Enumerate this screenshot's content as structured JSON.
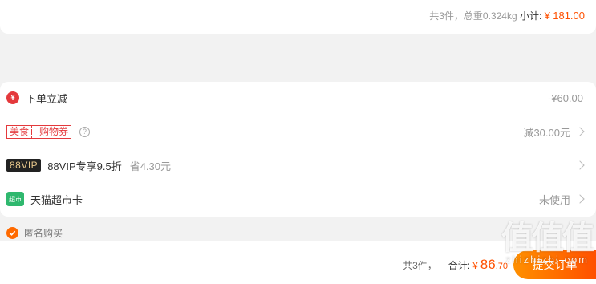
{
  "order_summary": {
    "count_text": "共3件，总重0.324kg",
    "subtotal_label": "小计:",
    "currency": "¥",
    "subtotal_value": "181.00"
  },
  "discounts": {
    "instant": {
      "label": "下单立减",
      "value": "-¥60.00",
      "icon": "red-coin-icon"
    },
    "coupon": {
      "tag_left": "美食",
      "tag_right": "购物券",
      "help": "?",
      "value": "减30.00元"
    },
    "vip": {
      "badge": "88VIP",
      "label": "88VIP专享9.5折",
      "save": "省4.30元"
    },
    "card": {
      "icon_text": "超市",
      "label": "天猫超市卡",
      "value": "未使用"
    }
  },
  "anonymous": {
    "label": "匿名购买",
    "checked": true
  },
  "footer": {
    "count": "共3件，",
    "total_label": "合计:",
    "currency": "¥",
    "total_int": "86",
    "total_dec": ".70",
    "submit": "提交订单"
  },
  "watermark": {
    "big": "值值值",
    "url": "zhizhizhi.com"
  },
  "colors": {
    "accent": "#ff5000",
    "red": "#e4393c",
    "green": "#2fb86e"
  }
}
